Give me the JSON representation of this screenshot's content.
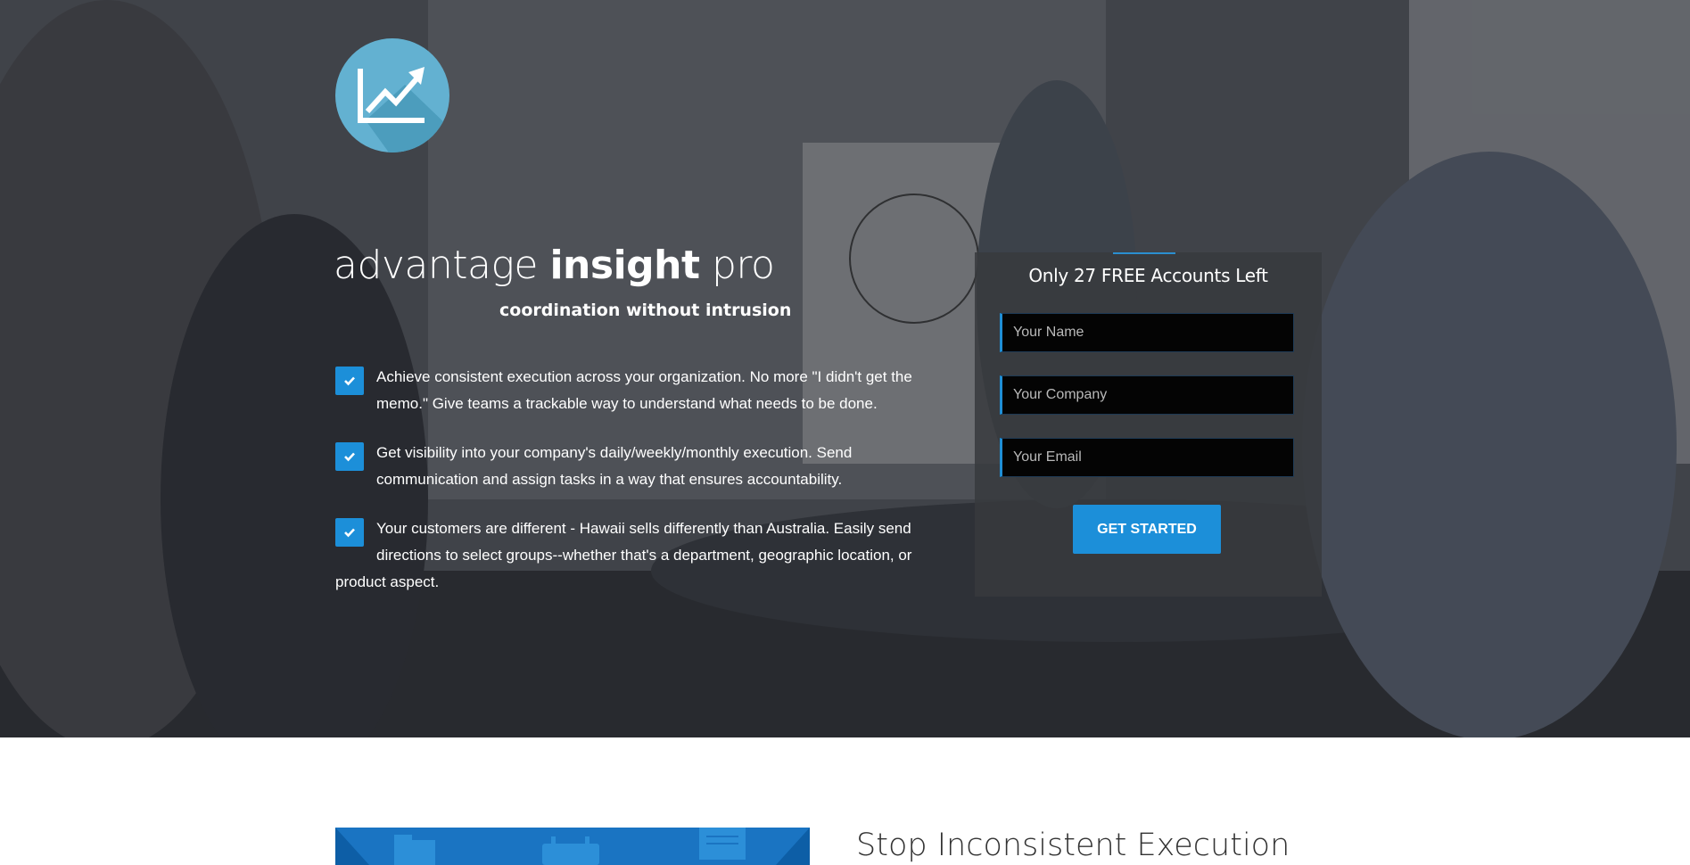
{
  "hero": {
    "brand": {
      "part1": "advantage ",
      "bold": "insight",
      "part3": " pro"
    },
    "tagline": "coordination without intrusion",
    "features": [
      "Achieve consistent execution across your organization. No more \"I didn't get the memo.\" Give teams a trackable way to understand what needs to be done.",
      "Get visibility into your company's daily/weekly/monthly execution. Send communication and assign tasks in a way that ensures accountability.",
      "Your customers are different - Hawaii sells differently than Australia. Easily send directions to select groups--whether that's a department, geographic location, or product aspect."
    ],
    "icons": {
      "logo": "line-chart-icon",
      "check": "checkmark-icon"
    }
  },
  "signup": {
    "title": "Only 27 FREE Accounts Left",
    "name_placeholder": "Your Name",
    "company_placeholder": "Your Company",
    "email_placeholder": "Your Email",
    "button_label": "GET STARTED"
  },
  "section": {
    "title": "Stop Inconsistent Execution"
  },
  "colors": {
    "accent": "#1c8fd9",
    "logo_circle": "#63b1d1",
    "illustration": "#1a74c2"
  }
}
